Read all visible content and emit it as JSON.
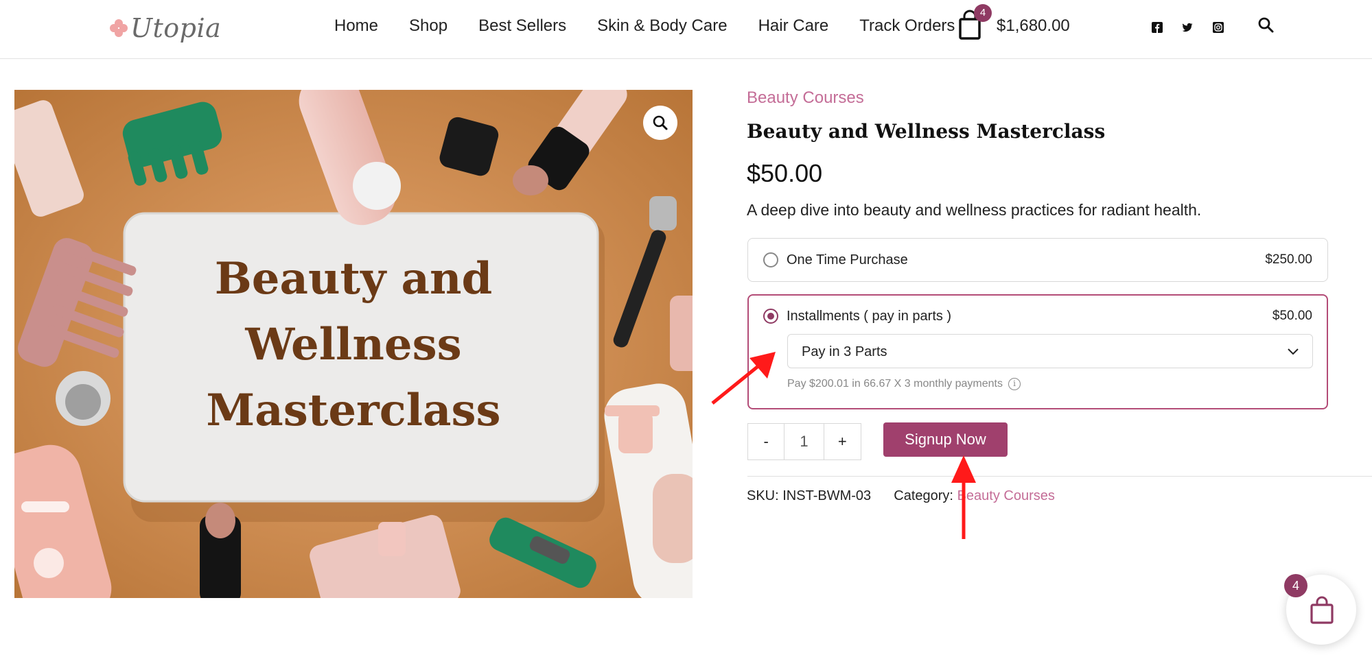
{
  "header": {
    "logo_text": "Utopia",
    "nav": [
      "Home",
      "Shop",
      "Best Sellers",
      "Skin & Body Care",
      "Hair Care",
      "Track Orders"
    ],
    "cart_count": "4",
    "cart_total": "$1,680.00",
    "social_icons": [
      "facebook-icon",
      "twitter-icon",
      "instagram-icon"
    ],
    "search_icon": "search-icon"
  },
  "product": {
    "image_text_lines": [
      "Beauty and",
      "Wellness",
      "Masterclass"
    ],
    "category": "Beauty Courses",
    "title": "Beauty and Wellness Masterclass",
    "price": "$50.00",
    "description": "A deep dive into beauty and wellness practices for radiant health."
  },
  "purchase_options": {
    "one_time": {
      "label": "One Time Purchase",
      "price": "$250.00",
      "selected": false
    },
    "installments": {
      "label": "Installments ( pay in parts )",
      "price": "$50.00",
      "selected": true,
      "select_value": "Pay in 3 Parts",
      "note": "Pay $200.01 in 66.67 X 3 monthly payments",
      "info_glyph": "i"
    }
  },
  "quantity": {
    "minus": "-",
    "value": "1",
    "plus": "+"
  },
  "signup_label": "Signup Now",
  "meta": {
    "sku_label": "SKU:",
    "sku_value": "INST-BWM-03",
    "category_label": "Category:",
    "category_value": "Beauty Courses"
  },
  "floating_cart": {
    "count": "4"
  },
  "colors": {
    "accent": "#8f3a63",
    "button": "#a0406d",
    "link": "#c46d97",
    "annotation": "#ff1a1a"
  }
}
